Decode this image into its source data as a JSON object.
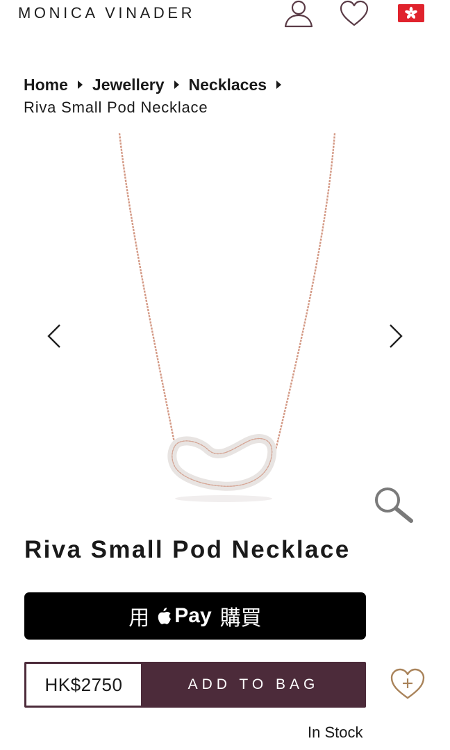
{
  "header": {
    "brand": "MONICA VINADER",
    "icons": [
      "account-icon",
      "wishlist-heart-icon",
      "hong-kong-flag-icon"
    ]
  },
  "breadcrumb": {
    "items": [
      "Home",
      "Jewellery",
      "Necklaces"
    ],
    "current": "Riva Small Pod Necklace"
  },
  "gallery": {
    "prev_icon": "chevron-left-icon",
    "next_icon": "chevron-right-icon",
    "zoom_icon": "magnifier-icon"
  },
  "product": {
    "title": "Riva Small Pod Necklace",
    "price": "HK$2750",
    "stock": "In Stock"
  },
  "buttons": {
    "applepay_prefix": "用",
    "applepay_pay": "Pay",
    "applepay_suffix": "購買",
    "add_to_bag": "ADD TO BAG"
  },
  "colors": {
    "buy_bar": "#4c2b3a",
    "chain": "#d9a08a",
    "accent_gold": "#a9835a"
  }
}
